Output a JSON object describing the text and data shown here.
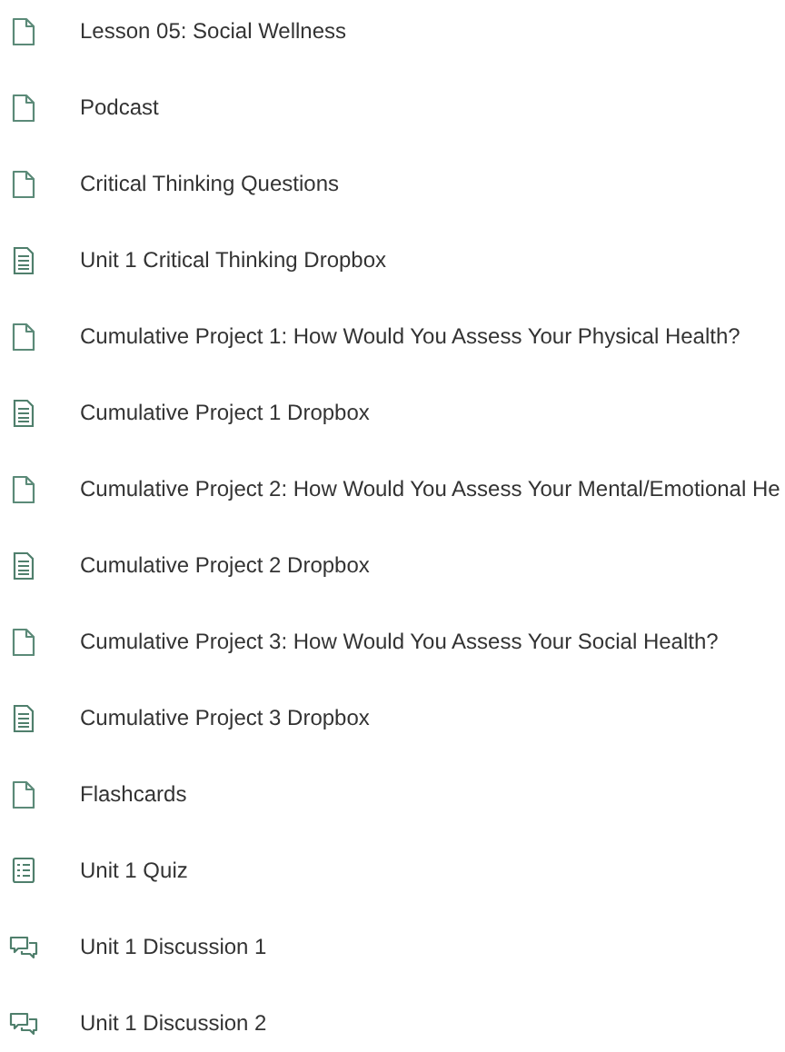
{
  "items": [
    {
      "kind": "page",
      "title": "Lesson 05: Social Wellness"
    },
    {
      "kind": "page",
      "title": "Podcast"
    },
    {
      "kind": "page",
      "title": "Critical Thinking Questions"
    },
    {
      "kind": "dropbox",
      "title": "Unit 1 Critical Thinking Dropbox"
    },
    {
      "kind": "page",
      "title": "Cumulative Project 1: How Would You Assess Your Physical Health?"
    },
    {
      "kind": "dropbox",
      "title": "Cumulative Project 1 Dropbox"
    },
    {
      "kind": "page",
      "title": "Cumulative Project 2: How Would You Assess Your Mental/Emotional He"
    },
    {
      "kind": "dropbox",
      "title": "Cumulative Project 2 Dropbox"
    },
    {
      "kind": "page",
      "title": "Cumulative Project 3: How Would You Assess Your Social Health?"
    },
    {
      "kind": "dropbox",
      "title": "Cumulative Project 3 Dropbox"
    },
    {
      "kind": "page",
      "title": "Flashcards"
    },
    {
      "kind": "quiz",
      "title": "Unit 1 Quiz"
    },
    {
      "kind": "discussion",
      "title": "Unit 1 Discussion 1"
    },
    {
      "kind": "discussion",
      "title": "Unit 1 Discussion 2"
    }
  ]
}
